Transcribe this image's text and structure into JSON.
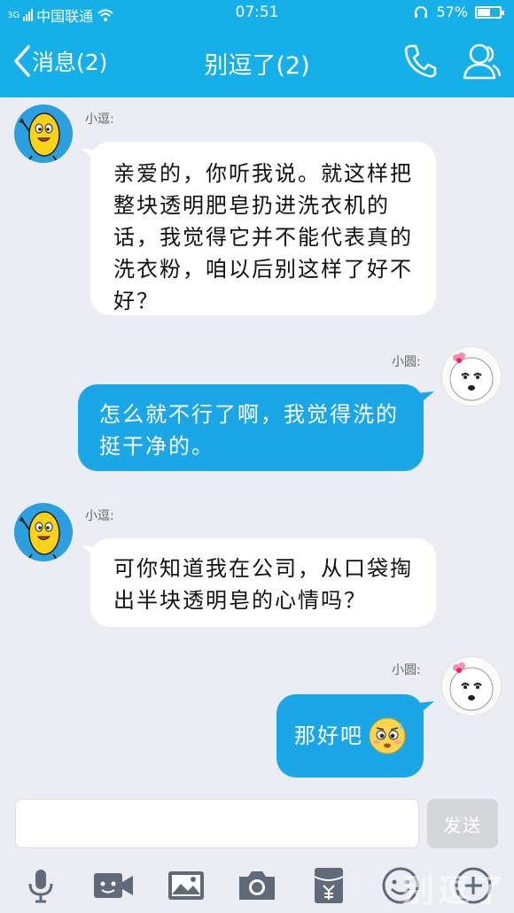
{
  "status_bar": {
    "carrier": "中国联通",
    "network": "3G",
    "time": "07:51",
    "battery": "57%",
    "battery_level": 0.57
  },
  "nav": {
    "back_label": "消息(2)",
    "title": "别逗了(2)"
  },
  "messages": [
    {
      "sender": "小逗:",
      "text": "亲爱的，你听我说。就这样把整块透明肥皂扔进洗衣机的话，我觉得它并不能代表真的洗衣粉，咱以后别这样了好不好？",
      "side": "left"
    },
    {
      "sender": "小圆:",
      "text": "怎么就不行了啊，我觉得洗的挺干净的。",
      "side": "right"
    },
    {
      "sender": "小逗:",
      "text": "可你知道我在公司，从口袋掏出半块透明皂的心情吗？",
      "side": "left"
    },
    {
      "sender": "小圆:",
      "text": "那好吧",
      "emoji": "worried-sweat-emoji",
      "side": "right"
    }
  ],
  "input": {
    "value": "",
    "send_label": "发送"
  },
  "toolbar": [
    "microphone-icon",
    "video-icon",
    "image-icon",
    "camera-icon",
    "red-packet-icon",
    "emoji-icon",
    "plus-icon"
  ],
  "watermark": "别逗了",
  "colors": {
    "brand": "#15b0ea",
    "bubble_blue": "#1aa6e7",
    "background": "#ebedf2"
  }
}
